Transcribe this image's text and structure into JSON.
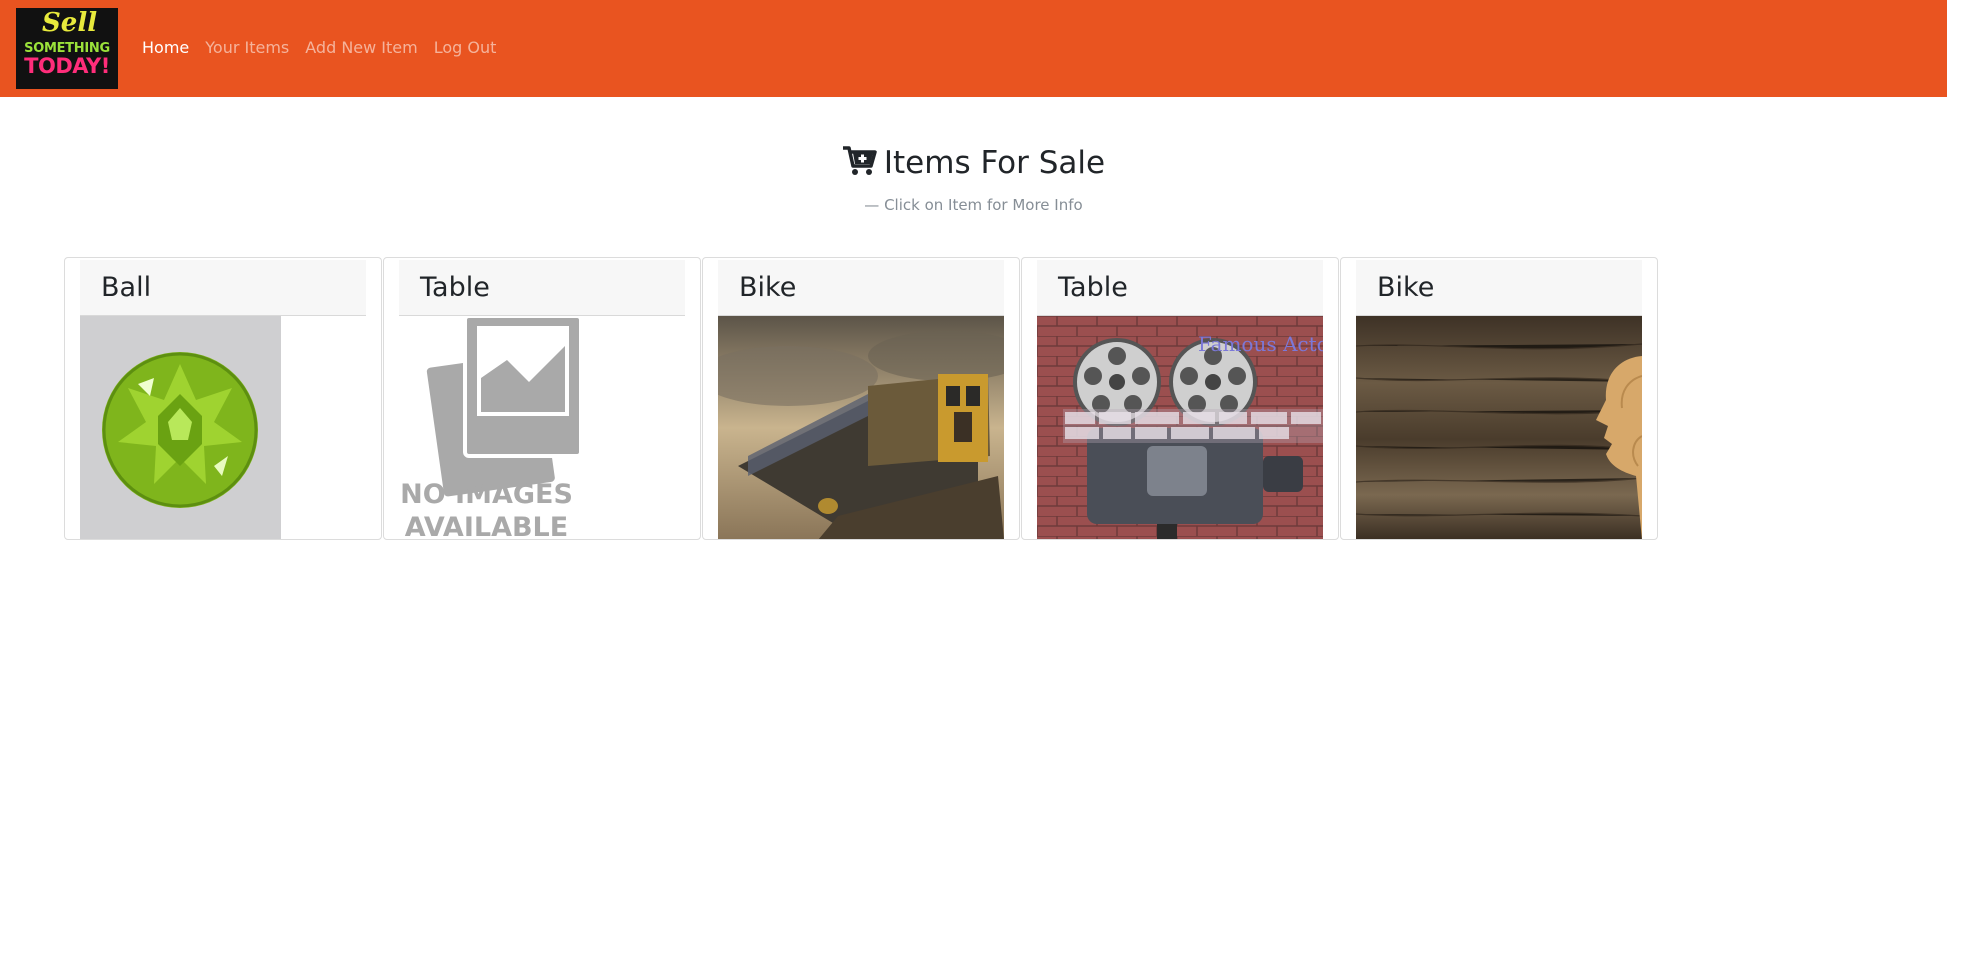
{
  "nav": {
    "logo": {
      "line1": "Sell",
      "line2": "SOMETHING",
      "line3": "TODAY!"
    },
    "links": [
      {
        "label": "Home",
        "active": true
      },
      {
        "label": "Your Items",
        "active": false
      },
      {
        "label": "Add New Item",
        "active": false
      },
      {
        "label": "Log Out",
        "active": false
      }
    ]
  },
  "page": {
    "title": "Items For Sale",
    "subtitle": "— Click on Item for More Info",
    "title_icon": "cart-plus-icon"
  },
  "items": [
    {
      "title": "Ball",
      "image": "green-gem"
    },
    {
      "title": "Table",
      "image": "no-images-placeholder",
      "placeholder_text": [
        "NO IMAGES",
        "AVAILABLE"
      ]
    },
    {
      "title": "Bike",
      "image": "train-in-clouds"
    },
    {
      "title": "Table",
      "image": "film-camera-brick-wall",
      "overlay_text": "Famous Actors"
    },
    {
      "title": "Bike",
      "image": "wooden-head-silhouette"
    }
  ],
  "colors": {
    "navbar": "#e95420",
    "card_header": "#f7f7f7",
    "muted_text": "#868e96"
  }
}
